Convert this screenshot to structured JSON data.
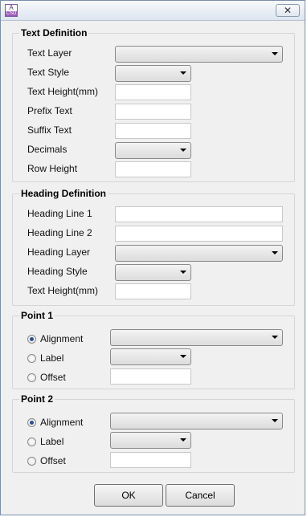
{
  "window": {
    "app_icon_text": "A",
    "app_icon_sub": "CSD",
    "close_label": "✕"
  },
  "text_definition": {
    "title": "Text Definition",
    "text_layer_label": "Text Layer",
    "text_style_label": "Text Style",
    "text_height_label": "Text Height(mm)",
    "prefix_text_label": "Prefix Text",
    "suffix_text_label": "Suffix Text",
    "decimals_label": "Decimals",
    "row_height_label": "Row Height",
    "text_layer_value": "",
    "text_style_value": "",
    "text_height_value": "",
    "prefix_text_value": "",
    "suffix_text_value": "",
    "decimals_value": "",
    "row_height_value": ""
  },
  "heading_definition": {
    "title": "Heading Definition",
    "heading_line1_label": "Heading Line 1",
    "heading_line2_label": "Heading Line 2",
    "heading_layer_label": "Heading Layer",
    "heading_style_label": "Heading Style",
    "text_height_label": "Text Height(mm)",
    "heading_line1_value": "",
    "heading_line2_value": "",
    "heading_layer_value": "",
    "heading_style_value": "",
    "text_height_value": ""
  },
  "point1": {
    "title": "Point 1",
    "alignment_label": "Alignment",
    "label_label": "Label",
    "offset_label": "Offset",
    "selected": "Alignment",
    "alignment_value": "",
    "label_value": "",
    "offset_value": ""
  },
  "point2": {
    "title": "Point 2",
    "alignment_label": "Alignment",
    "label_label": "Label",
    "offset_label": "Offset",
    "selected": "Alignment",
    "alignment_value": "",
    "label_value": "",
    "offset_value": ""
  },
  "buttons": {
    "ok_label": "OK",
    "cancel_label": "Cancel"
  }
}
